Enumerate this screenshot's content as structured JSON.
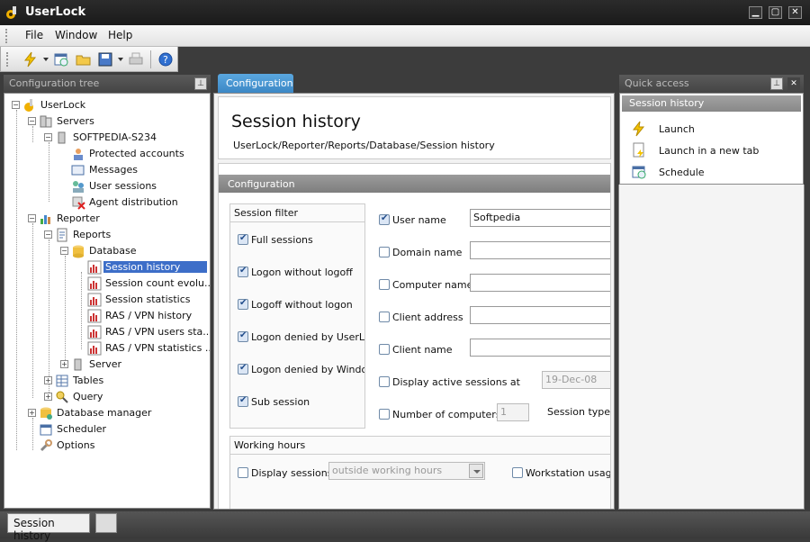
{
  "app": {
    "title": "UserLock"
  },
  "window_controls": {
    "minimize": "▁",
    "maximize": "▢",
    "close": "✕"
  },
  "menu": {
    "file": "File",
    "window": "Window",
    "help": "Help"
  },
  "toolbar": {
    "buttons": [
      "launch-icon",
      "schedule-icon",
      "open-folder-icon",
      "save-icon",
      "print-icon",
      "help-icon"
    ]
  },
  "left_panel": {
    "title": "Configuration tree",
    "tree": {
      "userlock": "UserLock",
      "servers": "Servers",
      "server_name": "SOFTPEDIA-S234",
      "protected_accounts": "Protected accounts",
      "messages": "Messages",
      "user_sessions": "User sessions",
      "agent_distribution": "Agent distribution",
      "reporter": "Reporter",
      "reports": "Reports",
      "database": "Database",
      "session_history": "Session history",
      "session_count": "Session count evolu...",
      "session_statistics": "Session statistics",
      "ras_vpn_history": "RAS / VPN history",
      "ras_vpn_users": "RAS / VPN users sta...",
      "ras_vpn_statistics": "RAS / VPN statistics ...",
      "server": "Server",
      "tables": "Tables",
      "query": "Query",
      "database_manager": "Database manager",
      "scheduler": "Scheduler",
      "options": "Options"
    }
  },
  "center": {
    "tab": "Configuration",
    "header_title": "Session history",
    "breadcrumb": "UserLock/Reporter/Reports/Database/Session history",
    "section_title": "Configuration",
    "session_filter": {
      "title": "Session filter",
      "items": [
        {
          "label": "Full sessions",
          "checked": true
        },
        {
          "label": "Logon without logoff",
          "checked": true
        },
        {
          "label": "Logoff without logon",
          "checked": true
        },
        {
          "label": "Logon denied by UserLoc",
          "checked": true
        },
        {
          "label": "Logon denied by Window",
          "checked": true
        },
        {
          "label": "Sub session",
          "checked": true
        }
      ]
    },
    "fields": {
      "user_name": {
        "label": "User name",
        "value": "Softpedia",
        "checked": true
      },
      "domain_name": {
        "label": "Domain name",
        "value": "",
        "checked": false
      },
      "computer_name": {
        "label": "Computer name",
        "value": "",
        "checked": false
      },
      "client_address": {
        "label": "Client address",
        "value": "",
        "checked": false
      },
      "client_name": {
        "label": "Client name",
        "value": "",
        "checked": false
      },
      "active_sessions": {
        "label": "Display active sessions at",
        "value": "19-Dec-08",
        "checked": false
      },
      "number_of_computers": {
        "label": "Number of computers",
        "value": "1",
        "checked": false
      },
      "session_types": "Session types"
    },
    "working_hours": {
      "title": "Working hours",
      "display_sessions": "Display sessions",
      "display_sessions_value": "outside working hours",
      "workstation_usage": "Workstation usage"
    }
  },
  "quick_access": {
    "title": "Quick access",
    "section": "Session history",
    "items": [
      "Launch",
      "Launch in a new tab",
      "Schedule"
    ]
  },
  "status": {
    "tab": "Session history"
  }
}
